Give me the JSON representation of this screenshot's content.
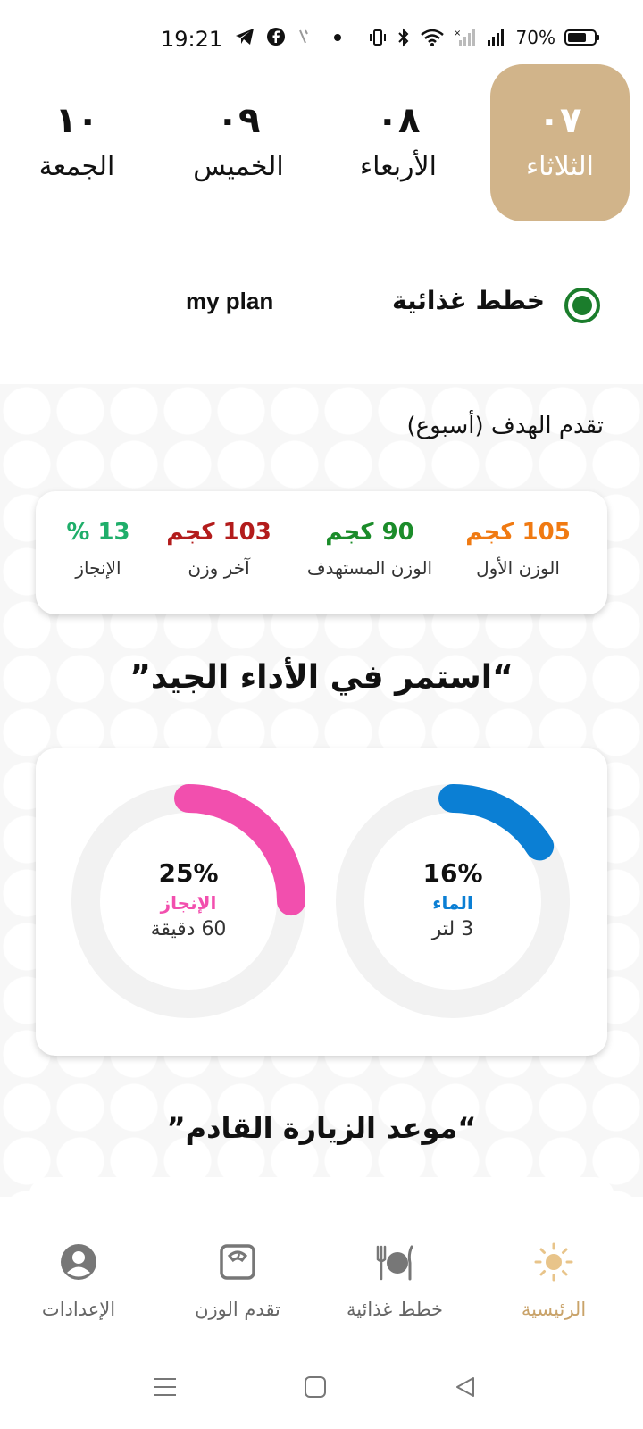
{
  "status_bar": {
    "time": "19:21",
    "battery": "70%"
  },
  "days": [
    {
      "num": "٠٧",
      "name": "الثلاثاء",
      "active": true
    },
    {
      "num": "٠٨",
      "name": "الأربعاء",
      "active": false
    },
    {
      "num": "٠٩",
      "name": "الخميس",
      "active": false
    },
    {
      "num": "١٠",
      "name": "الجمعة",
      "active": false
    }
  ],
  "plans": {
    "selected": "خطط غذائية",
    "other": "my plan"
  },
  "goal": {
    "title": "تقدم الهدف (أسبوع)",
    "stats": [
      {
        "value": "105 كجم",
        "label": "الوزن الأول",
        "color": "#f07a12"
      },
      {
        "value": "90 كجم",
        "label": "الوزن المستهدف",
        "color": "#1b8c2a"
      },
      {
        "value": "103 كجم",
        "label": "آخر وزن",
        "color": "#b31c1c"
      },
      {
        "value": "13 %",
        "label": "الإنجاز",
        "color": "#1fae6a"
      }
    ]
  },
  "motivation": "“استمر في الأداء الجيد”",
  "rings": [
    {
      "pct": "16%",
      "fraction": 0.16,
      "label": "الماء",
      "sub": "3 لتر",
      "color": "#0b7fd4"
    },
    {
      "pct": "25%",
      "fraction": 0.25,
      "label": "الإنجاز",
      "sub": "60 دقيقة",
      "color": "#f24fae"
    }
  ],
  "visit_title": "“موعد الزيارة القادم”",
  "nav": {
    "home": "الرئيسية",
    "meals": "خطط غذائية",
    "weight": "تقدم الوزن",
    "settings": "الإعدادات",
    "active_color": "#c9a36a"
  }
}
